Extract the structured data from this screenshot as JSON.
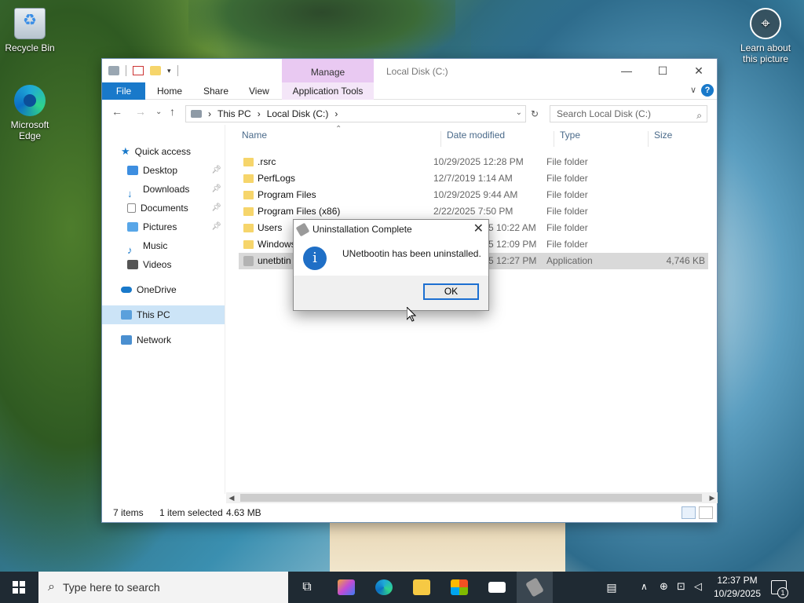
{
  "desktop": {
    "icons": [
      {
        "label": "Recycle Bin"
      },
      {
        "label": "Microsoft Edge"
      },
      {
        "label": "Learn about this picture"
      }
    ]
  },
  "explorer": {
    "title": "Local Disk (C:)",
    "manage_label": "Manage",
    "ribbon_tabs": {
      "file": "File",
      "home": "Home",
      "share": "Share",
      "view": "View",
      "app_tools": "Application Tools"
    },
    "address": {
      "this_pc": "This PC",
      "drive": "Local Disk (C:)"
    },
    "search_placeholder": "Search Local Disk (C:)",
    "nav": {
      "quick_access": "Quick access",
      "items": [
        "Desktop",
        "Downloads",
        "Documents",
        "Pictures",
        "Music",
        "Videos"
      ],
      "onedrive": "OneDrive",
      "this_pc": "This PC",
      "network": "Network"
    },
    "columns": {
      "name": "Name",
      "date": "Date modified",
      "type": "Type",
      "size": "Size"
    },
    "files": [
      {
        "name": ".rsrc",
        "date": "10/29/2025 12:28 PM",
        "type": "File folder",
        "size": ""
      },
      {
        "name": "PerfLogs",
        "date": "12/7/2019 1:14 AM",
        "type": "File folder",
        "size": ""
      },
      {
        "name": "Program Files",
        "date": "10/29/2025 9:44 AM",
        "type": "File folder",
        "size": ""
      },
      {
        "name": "Program Files (x86)",
        "date": "2/22/2025 7:50 PM",
        "type": "File folder",
        "size": ""
      },
      {
        "name": "Users",
        "date": "5 10:22 AM",
        "type": "File folder",
        "size": ""
      },
      {
        "name": "Windows",
        "date": "5 12:09 PM",
        "type": "File folder",
        "size": ""
      },
      {
        "name": "unetbtin",
        "date": "5 12:27 PM",
        "type": "Application",
        "size": "4,746 KB"
      }
    ],
    "status": {
      "items": "7 items",
      "selected": "1 item selected",
      "size": "4.63 MB"
    }
  },
  "dialog": {
    "title": "Uninstallation Complete",
    "message": "UNetbootin has been uninstalled.",
    "ok_label": "OK",
    "info_glyph": "i"
  },
  "taskbar": {
    "search_placeholder": "Type here to search",
    "time": "12:37 PM",
    "date": "10/29/2025",
    "notification_count": "1"
  },
  "colors": {
    "accent": "#1979ca",
    "manage_tab": "#e9c9f2",
    "selection": "#cce4f7",
    "taskbar": "#1f2a33"
  }
}
